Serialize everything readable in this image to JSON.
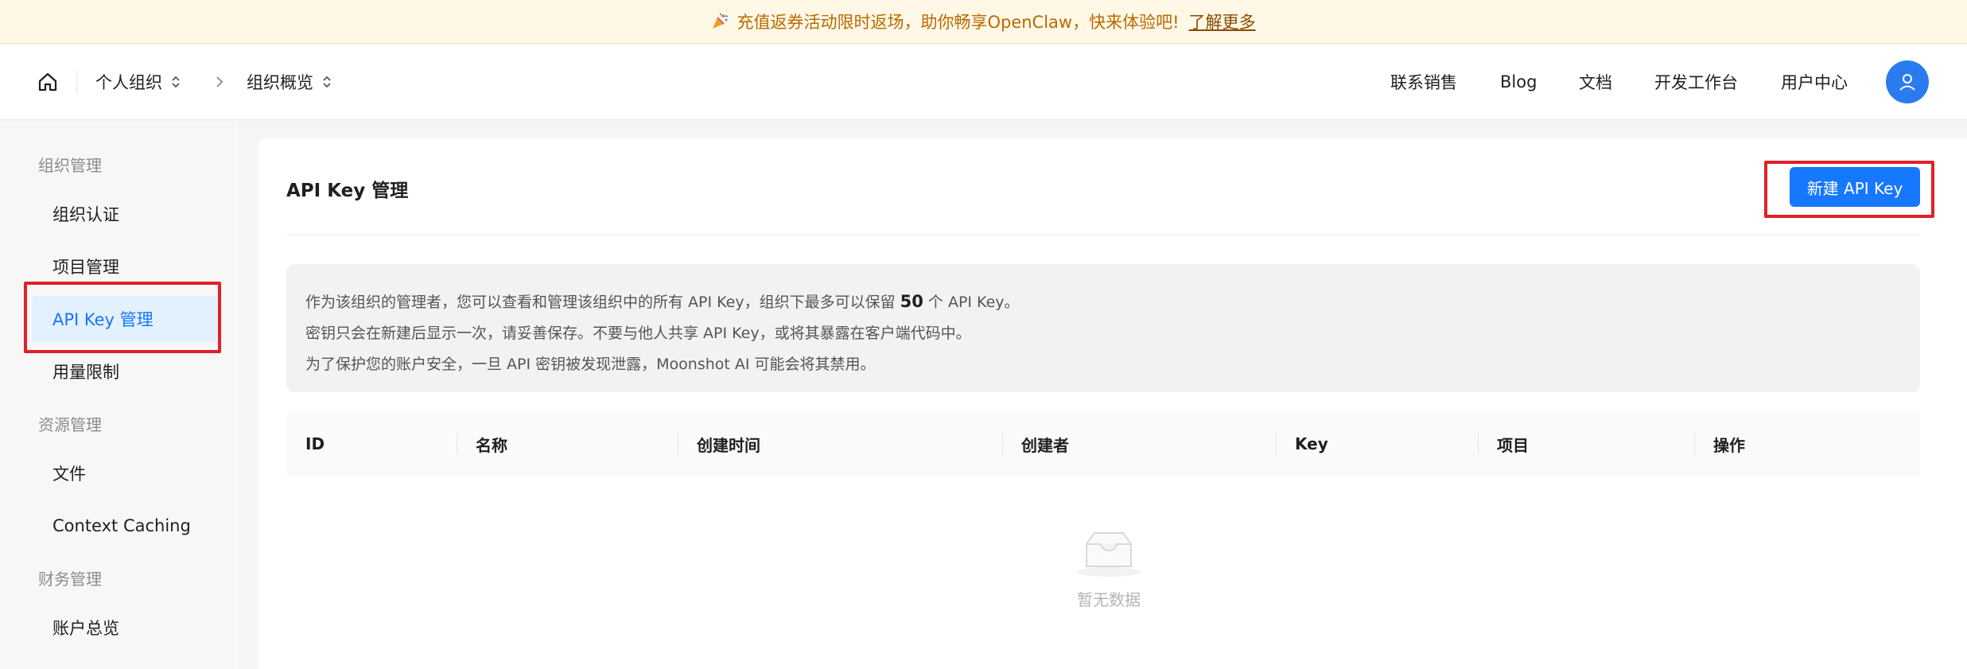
{
  "banner": {
    "text": "充值返券活动限时返场，助你畅享OpenClaw，快来体验吧!",
    "link": "了解更多"
  },
  "header": {
    "breadcrumb": [
      "个人组织",
      "组织概览"
    ],
    "nav": [
      "联系销售",
      "Blog",
      "文档",
      "开发工作台",
      "用户中心"
    ]
  },
  "sidebar": {
    "groups": [
      "组织管理",
      "资源管理",
      "财务管理"
    ],
    "items": [
      "组织认证",
      "项目管理",
      "API Key 管理",
      "用量限制",
      "文件",
      "Context Caching",
      "账户总览"
    ],
    "active_item": "API Key 管理"
  },
  "main": {
    "title": "API Key 管理",
    "new_button": "新建 API Key",
    "notice": {
      "line1_prefix": "作为该组织的管理者，您可以查看和管理该组织中的所有 API Key，组织下最多可以保留",
      "line1_number": "50",
      "line1_suffix": "个 API Key。",
      "line2": "密钥只会在新建后显示一次，请妥善保存。不要与他人共享 API Key，或将其暴露在客户端代码中。",
      "line3": "为了保护您的账户安全，一旦 API 密钥被发现泄露，Moonshot AI 可能会将其禁用。"
    },
    "table": {
      "columns": [
        "ID",
        "名称",
        "创建时间",
        "创建者",
        "Key",
        "项目",
        "操作"
      ],
      "rows": [],
      "empty_text": "暂无数据"
    }
  },
  "colors": {
    "accent": "#1677ff",
    "highlight_box": "#e0202a",
    "banner_bg": "#fff8e6"
  }
}
